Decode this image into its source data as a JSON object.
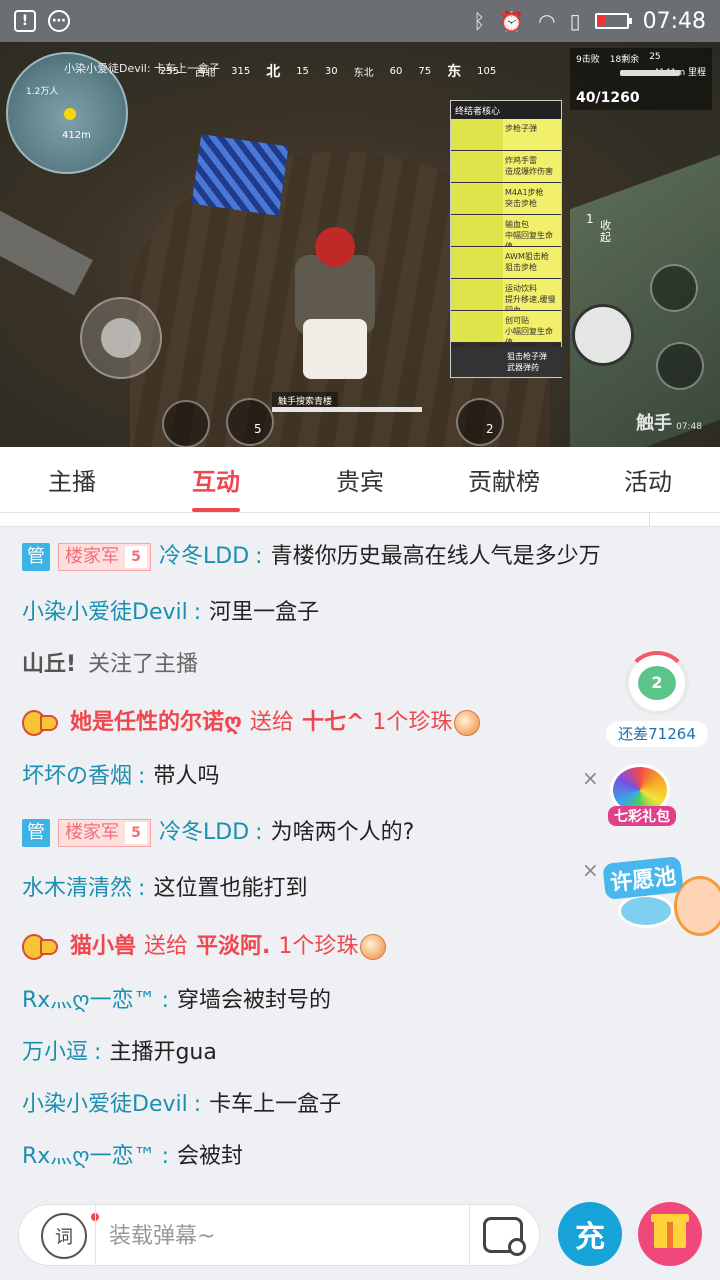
{
  "status_bar": {
    "time": "07:48",
    "left_icons": [
      "sim-alert-icon",
      "more-icon"
    ],
    "right_icons": [
      "bluetooth-icon",
      "alarm-icon",
      "wifi-icon",
      "sim-icon",
      "battery-low-icon"
    ],
    "battery_color": "#e33333"
  },
  "video": {
    "streamer_overlay": "小染小爱徒Devil: 卡车上一盒子",
    "map_subtitle": "1.2万人",
    "map_distance": "412m",
    "compass": [
      "255",
      "西北",
      "315",
      "北",
      "15",
      "30",
      "东北",
      "60",
      "75",
      "东",
      "105"
    ],
    "hud": {
      "kills": "9击败",
      "alive": "18剩余",
      "remaining": "25",
      "distance": "4141m 里程",
      "ammo": "40/1260"
    },
    "loot_title": "终结者核心",
    "loot_items": [
      {
        "line1": "步枪子弹",
        "line2": ""
      },
      {
        "line1": "炸鸡手雷",
        "line2": "造成爆炸伤害"
      },
      {
        "line1": "M4A1步枪",
        "line2": "突击步枪"
      },
      {
        "line1": "输血包",
        "line2": "中幅回复生命值"
      },
      {
        "line1": "AWM狙击枪",
        "line2": "狙击步枪"
      },
      {
        "line1": "运动饮料",
        "line2": "提升移速,缓慢回血"
      },
      {
        "line1": "创可贴",
        "line2": "小幅回复生命值"
      }
    ],
    "loot_footer_1": "狙击枪子弹",
    "loot_footer_2": "武器弹药",
    "hint": "触手搜索青楼",
    "grenade_count": "5",
    "chicken_count": "2",
    "side_count": "1",
    "side_label": "收起",
    "watermark": "触手",
    "watermark_time": "07:48"
  },
  "tabs": [
    {
      "label": "主播",
      "active": false
    },
    {
      "label": "互动",
      "active": true
    },
    {
      "label": "贵宾",
      "active": false
    },
    {
      "label": "贡献榜",
      "active": false
    },
    {
      "label": "活动",
      "active": false
    }
  ],
  "chat": {
    "messages": [
      {
        "type": "text",
        "admin_badge": "管",
        "fan_badge": "楼家军",
        "fan_level": "5",
        "user": "冷冬LDD",
        "sep": " : ",
        "text": "青楼你历史最高在线人气是多少万"
      },
      {
        "type": "text",
        "user": "小染小爱徒Devil",
        "sep": " : ",
        "text": "河里一盒子"
      },
      {
        "type": "follow",
        "user": "山丘!",
        "action": "关注了主播"
      },
      {
        "type": "gift",
        "sender": "她是任性的尔诺ღ",
        "verb": "送给",
        "receiver": "十七^",
        "amount": "1个珍珠"
      },
      {
        "type": "text",
        "user": "坏坏の香烟",
        "sep": " : ",
        "text": "带人吗"
      },
      {
        "type": "text",
        "admin_badge": "管",
        "fan_badge": "楼家军",
        "fan_level": "5",
        "user": "冷冬LDD",
        "sep": " : ",
        "text": "为啥两个人的?"
      },
      {
        "type": "text",
        "user": "水木清清然",
        "sep": " : ",
        "text": "这位置也能打到"
      },
      {
        "type": "gift",
        "sender": "猫小兽",
        "verb": "送给",
        "receiver": "平淡阿.",
        "amount": "1个珍珠"
      },
      {
        "type": "text",
        "user": "Rx灬ღ一恋™",
        "sep": " : ",
        "text": "穿墙会被封号的"
      },
      {
        "type": "text",
        "user": "万小逗",
        "sep": " : ",
        "text": "主播开gua"
      },
      {
        "type": "text",
        "user": "小染小爱徒Devil",
        "sep": " : ",
        "text": "卡车上一盒子"
      },
      {
        "type": "text",
        "user": "Rx灬ღ一恋™",
        "sep": " : ",
        "text": "会被封"
      }
    ]
  },
  "widgets": {
    "progress_label": "还差71264",
    "progress_fraction": 0.2,
    "frog_level": "2",
    "rainbow_label": "七彩礼包",
    "wish_label": "许愿池",
    "close_glyph": "×"
  },
  "input_bar": {
    "emoji_button_glyph": "词",
    "placeholder": "装载弹幕~",
    "charge_label": "充"
  },
  "colors": {
    "accent": "#f2464f",
    "username": "#1b8fb0",
    "admin_badge": "#3cb3e4",
    "charge": "#17a2d8",
    "gift_button": "#f0487a"
  }
}
